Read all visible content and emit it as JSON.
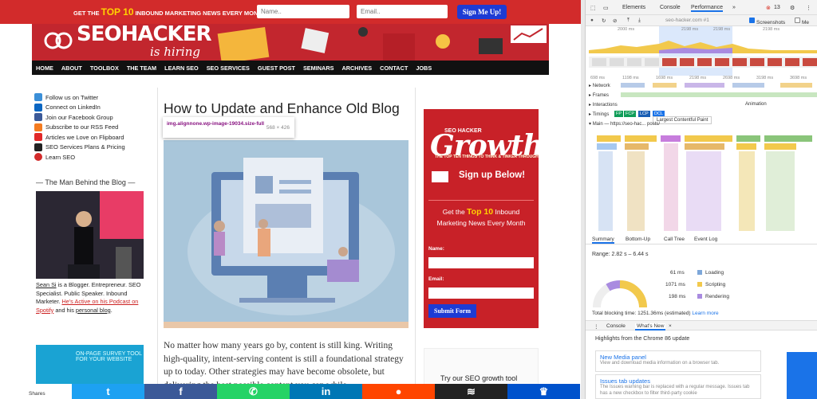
{
  "site": {
    "topbar": {
      "message_pre": "GET THE ",
      "message_num": "TOP 10",
      "message_post": " INBOUND MARKETING NEWS EVERY MONTH",
      "name_placeholder": "Name..",
      "email_placeholder": "Email..",
      "signup_label": "Sign Me Up!"
    },
    "banner": {
      "logo": "SEOHACKER",
      "tagline": "is hiring"
    },
    "nav": [
      "HOME",
      "ABOUT",
      "TOOLBOX",
      "THE TEAM",
      "LEARN SEO",
      "SEO SERVICES",
      "GUEST POST",
      "SEMINARS",
      "ARCHIVES",
      "CONTACT",
      "JOBS"
    ],
    "sidebar": {
      "follow": [
        {
          "label": "Follow us on Twitter",
          "icon": "twitter-icon",
          "color": "#3b8fd8"
        },
        {
          "label": "Connect on LinkedIn",
          "icon": "linkedin-icon",
          "color": "#0a66c2"
        },
        {
          "label": "Join our Facebook Group",
          "icon": "facebook-icon",
          "color": "#3b5998"
        },
        {
          "label": "Subscribe to our RSS Feed",
          "icon": "rss-icon",
          "color": "#f47b20"
        },
        {
          "label": "Articles we Love on Flipboard",
          "icon": "flipboard-icon",
          "color": "#e12828"
        },
        {
          "label": "SEO Services Plans & Pricing",
          "icon": "seo-s-icon",
          "color": "#222222"
        },
        {
          "label": "Learn SEO",
          "icon": "sh-icon",
          "color": "#d22b2b"
        }
      ],
      "man_heading": "— The Man Behind the Blog —",
      "bio_name": "Sean Si",
      "bio_text1": " is a Blogger. Entrepreneur. SEO Specialist. Public Speaker. Inbound Marketer. ",
      "bio_link": "He's Active on his Podcast on Spotify",
      "bio_text2": " and his ",
      "bio_link2": "personal blog",
      "bio_end": ".",
      "promo_text": "ON-PAGE SURVEY TOOL FOR YOUR WEBSITE"
    },
    "post": {
      "title": "How to Update and Enhance Old Blog",
      "tooltip_name": "img.alignnone.wp-image-19034.size-full",
      "tooltip_size": "568 × 426",
      "body": "No matter how many years go by, content is still king. Writing high-quality, intent-serving content is still a foundational strategy up to today. Other strategies may have become obsolete, but delivering the best possible content you can while"
    },
    "growth_box": {
      "brand": "SEO HACKER",
      "title": "Growth",
      "subtitle": "THE TOP TEN THINGS TO THINK & TINKER THROUGH",
      "signup": "Sign up Below!",
      "pitch_pre": "Get the ",
      "pitch_num": "Top 10",
      "pitch_post": " Inbound Marketing News Every Month",
      "name_label": "Name:",
      "email_label": "Email:",
      "submit_label": "Submit Form"
    },
    "try_tool": "Try our SEO growth tool",
    "share": {
      "label": "Shares",
      "buttons": [
        {
          "icon": "twitter-icon",
          "color": "#1da1f2",
          "glyph": "t"
        },
        {
          "icon": "facebook-icon",
          "color": "#3b5998",
          "glyph": "f"
        },
        {
          "icon": "whatsapp-icon",
          "color": "#25d366",
          "glyph": "✆"
        },
        {
          "icon": "linkedin-icon",
          "color": "#0077b5",
          "glyph": "in"
        },
        {
          "icon": "reddit-icon",
          "color": "#ff4500",
          "glyph": "●"
        },
        {
          "icon": "buffer-icon",
          "color": "#222222",
          "glyph": "≋"
        },
        {
          "icon": "sumo-icon",
          "color": "#0052cc",
          "glyph": "♛"
        }
      ]
    }
  },
  "devtools": {
    "tabs": [
      "Elements",
      "Console",
      "Performance"
    ],
    "more": "»",
    "errors": "13",
    "url": "seo-hacker.com #1",
    "screenshots_label": "Screenshots",
    "memory_label": "Me",
    "overview_ticks": [
      "2000 ms",
      "2198 ms",
      "2198 ms",
      "2198 ms"
    ],
    "filmstrip_ticks": [
      "698 ms",
      "1198 ms",
      "1698 ms",
      "2198 ms",
      "2698 ms",
      "3198 ms",
      "3698 ms"
    ],
    "tracks": {
      "network": "Network",
      "frames": "Frames",
      "interactions": "Interactions",
      "animation": "Animation",
      "timings": "Timings",
      "main": "Main — https://seo-hac... posts/",
      "lcp_tooltip": "Largest Contentful Paint",
      "markers": [
        "FP",
        "FCP",
        "LCP",
        "DCL"
      ]
    },
    "summary_tabs": [
      "Summary",
      "Bottom-Up",
      "Call Tree",
      "Event Log"
    ],
    "range": "Range: 2.82 s – 6.44 s",
    "legend": [
      {
        "value": "61 ms",
        "label": "Loading",
        "color": "#7da7d9"
      },
      {
        "value": "1071 ms",
        "label": "Scripting",
        "color": "#f2c94c"
      },
      {
        "value": "198 ms",
        "label": "Rendering",
        "color": "#a98be0"
      }
    ],
    "total_blocking": "Total blocking time: 1251.36ms (estimated)",
    "learn_more": "Learn more",
    "drawer_tabs": [
      "Console",
      "What's New"
    ],
    "highlights": "Highlights from the Chrome 86 update",
    "cards": [
      {
        "title": "New Media panel",
        "desc": "View and download media information on a browser tab."
      },
      {
        "title": "Issues tab updates",
        "desc": "The Issues warning bar is replaced with a regular message. Issues tab has a new checkbox to filter third-party cookie"
      }
    ]
  }
}
